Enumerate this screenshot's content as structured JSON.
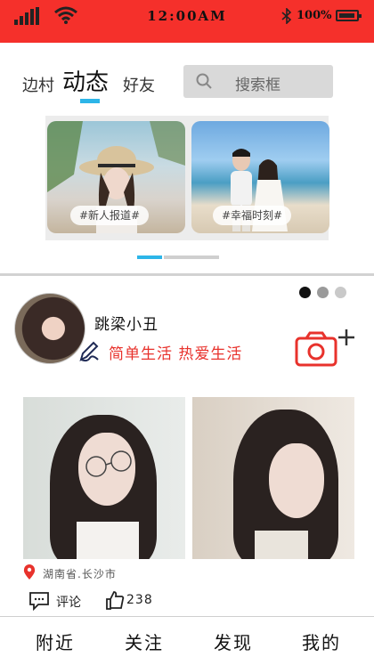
{
  "status_bar": {
    "time": "12:00AM",
    "battery": "100%",
    "icons": [
      "signal-icon",
      "wifi-icon",
      "bluetooth-icon",
      "battery-icon"
    ]
  },
  "top_tabs": [
    {
      "label": "边村",
      "active": false
    },
    {
      "label": "动态",
      "active": true
    },
    {
      "label": "好友",
      "active": false
    }
  ],
  "search": {
    "text": "搜索框"
  },
  "banner": {
    "cards": [
      {
        "tag": "#新人报道#"
      },
      {
        "tag": "#幸福时刻#"
      }
    ]
  },
  "post": {
    "username": "跳梁小丑",
    "motto": "简单生活 热爱生活",
    "location": "湖南省.长沙市",
    "comment_label": "评论",
    "like_count": "238"
  },
  "bottom_nav": [
    {
      "label": "附近"
    },
    {
      "label": "关注"
    },
    {
      "label": "发现"
    },
    {
      "label": "我的"
    }
  ],
  "colors": {
    "status_bar": "#f5302b",
    "accent_blue": "#2db5e8",
    "motto_red": "#e8322c"
  }
}
